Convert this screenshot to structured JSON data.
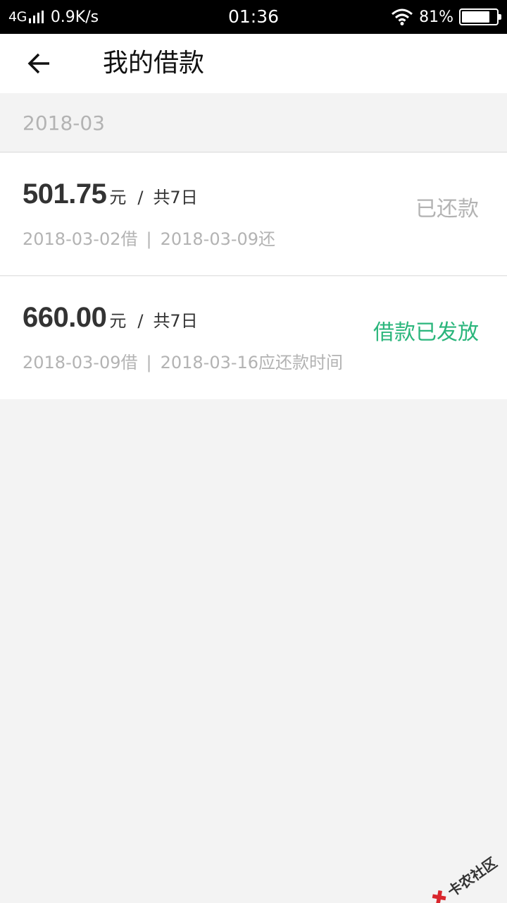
{
  "status_bar": {
    "network": "4G",
    "speed": "0.9K/s",
    "time": "01:36",
    "battery_percent": "81%",
    "battery_level": 0.81
  },
  "nav": {
    "title": "我的借款"
  },
  "month": "2018-03",
  "loans": [
    {
      "amount": "501.75",
      "unit": "元",
      "separator": "/",
      "term": "共7日",
      "borrow_date": "2018-03-02借",
      "divider": "|",
      "due_date": "2018-03-09还",
      "status": "已还款"
    },
    {
      "amount": "660.00",
      "unit": "元",
      "separator": "/",
      "term": "共7日",
      "borrow_date": "2018-03-09借",
      "divider": "|",
      "due_date": "2018-03-16应还款时间",
      "status": "借款已发放"
    }
  ],
  "watermark": "卡农社区",
  "colors": {
    "status_repaid": "#b3b3b3",
    "status_issued": "#2bb67c",
    "background": "#f3f3f3"
  },
  "icons": {
    "back": "arrow-left-icon",
    "signal": "signal-icon",
    "wifi": "wifi-icon",
    "battery": "battery-icon"
  }
}
